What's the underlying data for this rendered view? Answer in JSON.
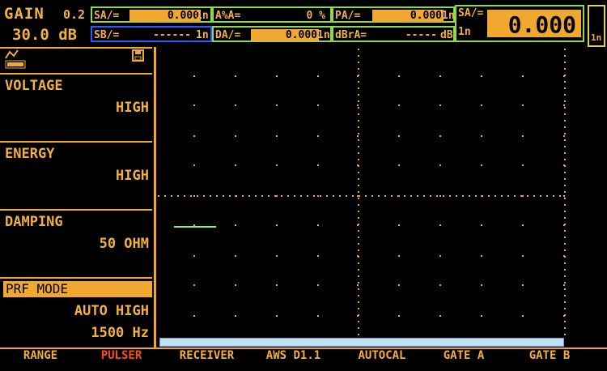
{
  "header": {
    "gain_label": "GAIN",
    "gain_step": "0.2",
    "gain_value": "30.0 dB",
    "readouts": [
      {
        "label": "SA/=",
        "value": "0.000",
        "unit": "1n"
      },
      {
        "label": "A%A=",
        "value": "0 %",
        "unit": ""
      },
      {
        "label": "PA/=",
        "value": "0.000",
        "unit": "1n"
      },
      {
        "label": "SB/=",
        "value": "------",
        "unit": "1n"
      },
      {
        "label": "DA/=",
        "value": "0.000",
        "unit": "1n"
      },
      {
        "label": "dBrA=",
        "value": "-----",
        "unit": "dB"
      }
    ],
    "big_readout": {
      "label": "SA/=",
      "unit": "1n",
      "value": "0.000"
    },
    "strip_unit": "1n"
  },
  "left_panel": {
    "items": [
      {
        "title": "VOLTAGE",
        "value": "HIGH"
      },
      {
        "title": "ENERGY",
        "value": "HIGH"
      },
      {
        "title": "DAMPING",
        "value": "50 OHM"
      },
      {
        "title": "PRF MODE",
        "value": "AUTO HIGH",
        "value2": "1500 Hz"
      }
    ]
  },
  "bottom_menu": [
    {
      "label": "RANGE",
      "active": false
    },
    {
      "label": "PULSER",
      "active": true
    },
    {
      "label": "RECEIVER",
      "active": false
    },
    {
      "label": "AWS D1.1",
      "active": false
    },
    {
      "label": "AUTOCAL",
      "active": false
    },
    {
      "label": "GATE A",
      "active": false
    },
    {
      "label": "GATE B",
      "active": false
    }
  ],
  "colors": {
    "accent": "#f0a830",
    "active_menu": "#ff4a1a",
    "gate_line": "#7ef08a",
    "box_green": "#8fd84a",
    "box_blue": "#2a5cff",
    "box_yellow": "#e2d24a"
  },
  "icons": [
    "waveform-icon",
    "save-icon"
  ]
}
